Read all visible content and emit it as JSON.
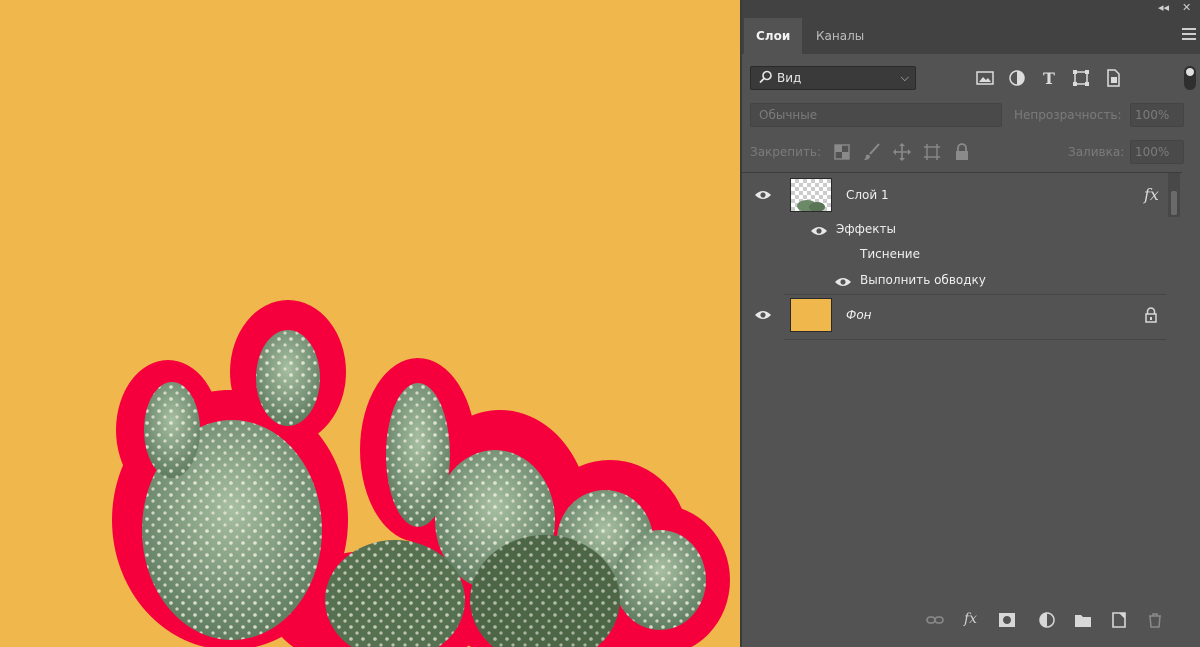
{
  "panel": {
    "tabs": [
      {
        "label": "Слои",
        "active": true
      },
      {
        "label": "Каналы",
        "active": false
      }
    ],
    "filter": {
      "label": "Вид"
    },
    "blend_mode": "Обычные",
    "opacity_label": "Непрозрачность:",
    "opacity_value": "100%",
    "lock_label": "Закрепить:",
    "fill_label": "Заливка:",
    "fill_value": "100%",
    "layers": [
      {
        "name": "Слой 1",
        "fx": "fx",
        "effects_label": "Эффекты",
        "effects": [
          "Тиснение",
          "Выполнить обводку"
        ]
      },
      {
        "name": "Фон",
        "locked": true
      }
    ]
  },
  "colors": {
    "canvas_bg": "#f0b84c",
    "stroke": "#f5003c",
    "panel_bg": "#535353",
    "cactus": "#7e9a7d"
  },
  "icons": [
    "search-icon",
    "image-filter-icon",
    "adjustment-filter-icon",
    "type-filter-icon",
    "shape-filter-icon",
    "smart-object-filter-icon",
    "lock-transparent-icon",
    "lock-brush-icon",
    "lock-move-icon",
    "lock-artboard-icon",
    "lock-all-icon",
    "eye-icon",
    "fx-icon",
    "lock-icon",
    "link-icon",
    "mask-icon",
    "adjustment-icon",
    "folder-icon",
    "new-layer-icon",
    "trash-icon",
    "panel-menu-icon"
  ]
}
